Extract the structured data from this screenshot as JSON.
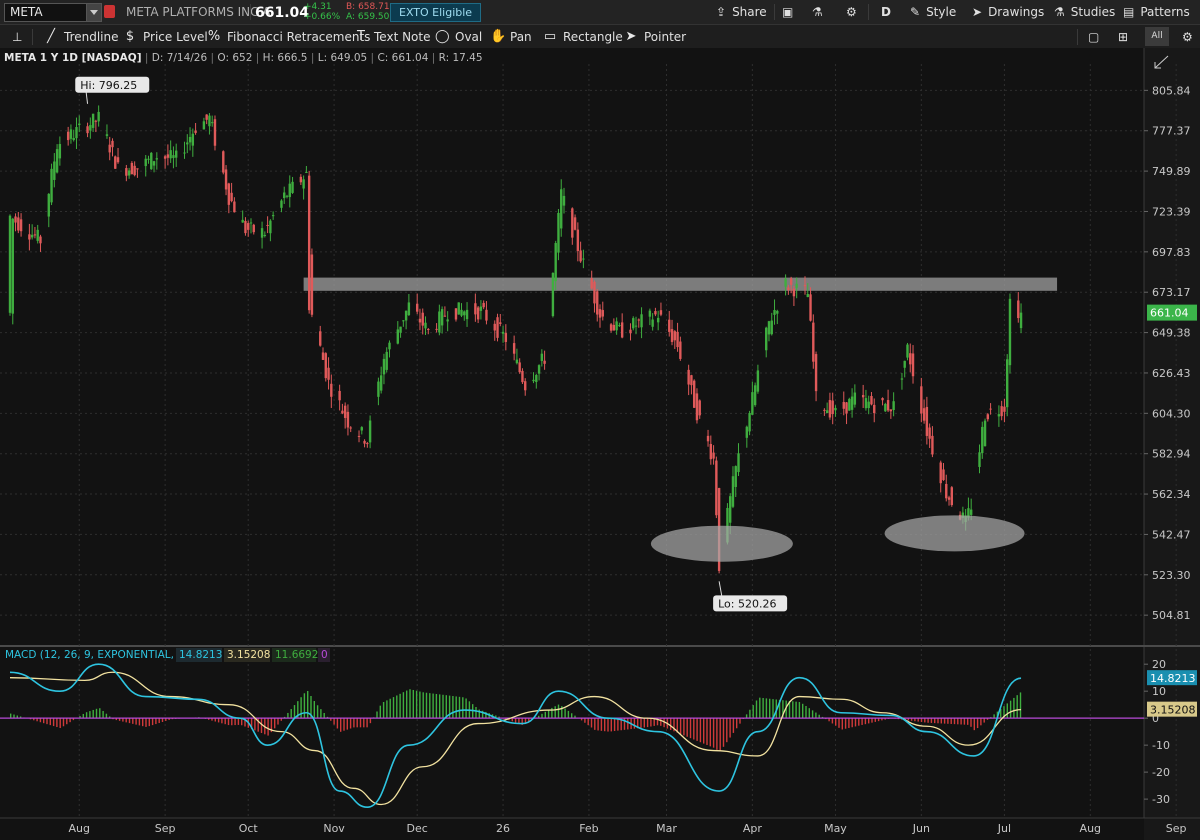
{
  "toolbar": {
    "symbol": "META",
    "company": "META PLATFORMS INC A",
    "last": "661.04",
    "change": "+4.31",
    "change_pct": "+0.66%",
    "bid": "B: 658.71",
    "ask": "A: 659.50",
    "exto": "EXTO Eligible",
    "share": "Share",
    "aggregation": "D",
    "style": "Style",
    "drawings": "Drawings",
    "studies": "Studies",
    "patterns": "Patterns"
  },
  "drawing_tools": {
    "trendline": "Trendline",
    "price_level": "Price Level",
    "fib": "Fibonacci Retracements",
    "text_note": "Text Note",
    "oval": "Oval",
    "pan": "Pan",
    "rectangle": "Rectangle",
    "pointer": "Pointer",
    "all": "All"
  },
  "info_bar": {
    "title": "META 1 Y 1D [NASDAQ]",
    "date": "D: 7/14/26",
    "open": "O: 652",
    "high": "H: 666.5",
    "low": "L: 649.05",
    "close": "C: 661.04",
    "range": "R: 17.45"
  },
  "colors": {
    "up": "#3fae3f",
    "down": "#e05a5a",
    "macd": "#2ec4e0",
    "signal": "#f2e2a0",
    "zero": "#b84ad8",
    "grid": "#2e2e2e",
    "price_tag": "#3bb54a"
  },
  "chart_data": {
    "type": "candlestick",
    "price_axis": {
      "ticks": [
        805.84,
        777.37,
        749.89,
        723.39,
        697.83,
        673.17,
        649.38,
        626.43,
        604.3,
        582.94,
        562.34,
        542.47,
        523.3,
        504.81
      ],
      "scale": "log",
      "last_price": "661.04"
    },
    "time_axis": {
      "labels": [
        "Aug",
        "Sep",
        "Oct",
        "Nov",
        "Dec",
        "26",
        "Feb",
        "Mar",
        "Apr",
        "May",
        "Jun",
        "Jul",
        "Aug",
        "Sep"
      ]
    },
    "annotations": {
      "high_label": "Hi: 796.25",
      "low_label": "Lo: 520.26",
      "resistance_zone": [
        674,
        682
      ],
      "ovals": [
        "support zone Mar/Apr ~537",
        "support zone Jun ~543"
      ]
    },
    "price_path": [
      [
        "2025-07-14",
        720
      ],
      [
        "2025-07-25",
        705
      ],
      [
        "2025-07-31",
        768
      ],
      [
        "2025-08-08",
        778
      ],
      [
        "2025-08-15",
        786
      ],
      [
        "2025-08-22",
        752
      ],
      [
        "2025-08-29",
        752
      ],
      [
        "2025-09-05",
        760
      ],
      [
        "2025-09-12",
        758
      ],
      [
        "2025-09-19",
        780
      ],
      [
        "2025-09-24",
        786
      ],
      [
        "2025-10-01",
        733
      ],
      [
        "2025-10-07",
        712
      ],
      [
        "2025-10-14",
        710
      ],
      [
        "2025-10-21",
        733
      ],
      [
        "2025-10-29",
        748
      ],
      [
        "2025-10-30",
        666
      ],
      [
        "2025-11-06",
        621
      ],
      [
        "2025-11-13",
        600
      ],
      [
        "2025-11-20",
        590
      ],
      [
        "2025-11-26",
        635
      ],
      [
        "2025-12-05",
        665
      ],
      [
        "2025-12-12",
        650
      ],
      [
        "2025-12-19",
        662
      ],
      [
        "2025-12-31",
        662
      ],
      [
        "2026-01-09",
        646
      ],
      [
        "2026-01-16",
        620
      ],
      [
        "2026-01-23",
        635
      ],
      [
        "2026-01-29",
        735
      ],
      [
        "2026-02-05",
        695
      ],
      [
        "2026-02-12",
        660
      ],
      [
        "2026-02-19",
        650
      ],
      [
        "2026-02-26",
        655
      ],
      [
        "2026-03-05",
        660
      ],
      [
        "2026-03-12",
        642
      ],
      [
        "2026-03-19",
        605
      ],
      [
        "2026-03-25",
        580
      ],
      [
        "2026-03-27",
        528
      ],
      [
        "2026-04-02",
        575
      ],
      [
        "2026-04-08",
        612
      ],
      [
        "2026-04-14",
        655
      ],
      [
        "2026-04-20",
        678
      ],
      [
        "2026-04-28",
        672
      ],
      [
        "2026-05-01",
        612
      ],
      [
        "2026-05-08",
        604
      ],
      [
        "2026-05-15",
        612
      ],
      [
        "2026-05-22",
        609
      ],
      [
        "2026-05-29",
        608
      ],
      [
        "2026-06-03",
        640
      ],
      [
        "2026-06-10",
        595
      ],
      [
        "2026-06-17",
        563
      ],
      [
        "2026-06-24",
        548
      ],
      [
        "2026-06-26",
        557
      ],
      [
        "2026-07-01",
        604
      ],
      [
        "2026-07-08",
        608
      ],
      [
        "2026-07-10",
        668
      ],
      [
        "2026-07-14",
        661.04
      ]
    ],
    "macd": {
      "label": "MACD (12, 26, 9, EXPONENTIAL, no)",
      "value": "14.8213",
      "avg": "3.15208",
      "diff": "11.6692",
      "zero_label": "0",
      "ticks": [
        20,
        10,
        0,
        -10,
        -20,
        -30
      ],
      "macd_path": [
        [
          "2025-07-14",
          17
        ],
        [
          "2025-08-01",
          10
        ],
        [
          "2025-08-15",
          20
        ],
        [
          "2025-09-01",
          8
        ],
        [
          "2025-09-20",
          7
        ],
        [
          "2025-10-05",
          0
        ],
        [
          "2025-10-15",
          -10
        ],
        [
          "2025-10-29",
          2
        ],
        [
          "2025-11-10",
          -27
        ],
        [
          "2025-11-20",
          -33
        ],
        [
          "2025-12-05",
          -10
        ],
        [
          "2025-12-25",
          3
        ],
        [
          "2026-01-15",
          -2
        ],
        [
          "2026-01-28",
          10
        ],
        [
          "2026-02-15",
          0
        ],
        [
          "2026-03-05",
          -5
        ],
        [
          "2026-03-27",
          -27
        ],
        [
          "2026-04-10",
          -5
        ],
        [
          "2026-04-25",
          15
        ],
        [
          "2026-05-10",
          2
        ],
        [
          "2026-05-28",
          1
        ],
        [
          "2026-06-10",
          -5
        ],
        [
          "2026-06-27",
          -14
        ],
        [
          "2026-07-14",
          14.82
        ]
      ],
      "signal_path": [
        [
          "2025-07-14",
          15
        ],
        [
          "2025-08-10",
          14
        ],
        [
          "2025-08-20",
          17
        ],
        [
          "2025-09-10",
          8
        ],
        [
          "2025-10-01",
          5
        ],
        [
          "2025-10-20",
          -5
        ],
        [
          "2025-11-01",
          -12
        ],
        [
          "2025-11-15",
          -26
        ],
        [
          "2025-11-25",
          -32
        ],
        [
          "2025-12-10",
          -18
        ],
        [
          "2025-12-30",
          -2
        ],
        [
          "2026-01-25",
          3
        ],
        [
          "2026-02-10",
          8
        ],
        [
          "2026-03-01",
          0
        ],
        [
          "2026-03-25",
          -12
        ],
        [
          "2026-04-10",
          -14
        ],
        [
          "2026-04-25",
          8
        ],
        [
          "2026-05-10",
          7
        ],
        [
          "2026-05-25",
          2
        ],
        [
          "2026-06-10",
          -3
        ],
        [
          "2026-06-25",
          -10
        ],
        [
          "2026-07-14",
          3.15
        ]
      ]
    }
  }
}
